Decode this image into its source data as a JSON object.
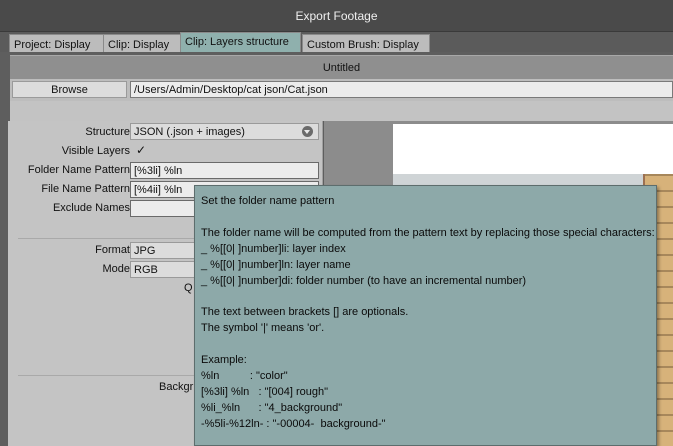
{
  "window": {
    "title": "Export Footage"
  },
  "tabs": [
    {
      "label": "Project: Display",
      "active": false
    },
    {
      "label": "Clip: Display",
      "active": false
    },
    {
      "label": "Clip: Layers structure",
      "active": true
    },
    {
      "label": "Custom Brush: Display",
      "active": false
    }
  ],
  "header": {
    "title": "Untitled"
  },
  "browse": {
    "button_label": "Browse",
    "path": "/Users/Admin/Desktop/cat json/Cat.json"
  },
  "form": {
    "structure": {
      "label": "Structure",
      "value": "JSON (.json + images)"
    },
    "visible_layers": {
      "label": "Visible Layers",
      "checked": true,
      "check_glyph": "✓"
    },
    "folder_name_pattern": {
      "label": "Folder Name Pattern",
      "value": "[%3li] %ln"
    },
    "file_name_pattern": {
      "label": "File Name Pattern",
      "value": "[%4ii] %ln"
    },
    "exclude_names": {
      "label": "Exclude Names",
      "value": ""
    },
    "format": {
      "label": "Format",
      "value": "JPG"
    },
    "mode": {
      "label": "Mode",
      "value": "RGB"
    },
    "quality_partial": "Q",
    "background_partial": "Backgr"
  },
  "tooltip": {
    "title": "Set the folder name pattern",
    "intro": "The folder name will be computed from the pattern text by replacing those special characters:",
    "codes": [
      "_ %[[0| ]number]li: layer index",
      "_ %[[0| ]number]ln: layer name",
      "_ %[[0| ]number]di: folder number (to have an incremental number)"
    ],
    "note1": "The text between brackets [] are optionals.",
    "note2": "The symbol '|' means 'or'.",
    "example_label": "Example:",
    "examples": [
      "%ln          : \"color\"",
      "[%3li] %ln   : \"[004] rough\"",
      "%li_%ln      : \"4_background\"",
      "-%5li-%12ln- : \"-00004-  background-\""
    ]
  },
  "colors": {
    "active_tab": "#8fb0ad",
    "tooltip_bg": "#8da9a9",
    "panel_bg": "#c4c4c4"
  }
}
